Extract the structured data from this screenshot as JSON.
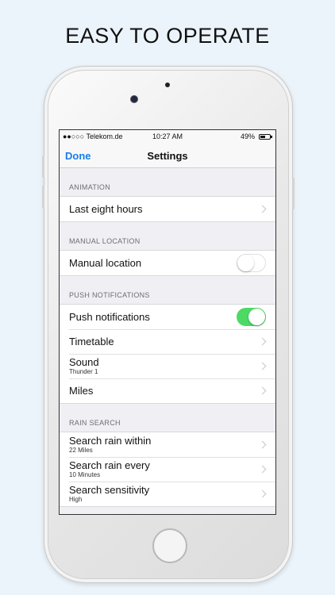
{
  "headline": "EASY TO OPERATE",
  "status_bar": {
    "carrier": "●●○○○ Telekom.de",
    "time": "10:27 AM",
    "battery": "49%"
  },
  "nav": {
    "done_label": "Done",
    "title": "Settings"
  },
  "sections": {
    "animation": {
      "header": "ANIMATION",
      "rows": [
        {
          "label": "Last eight hours"
        }
      ]
    },
    "manual_location": {
      "header": "MANUAL LOCATION",
      "rows": [
        {
          "label": "Manual location",
          "toggle": false
        }
      ]
    },
    "push_notifications": {
      "header": "PUSH NOTIFICATIONS",
      "rows": [
        {
          "label": "Push notifications",
          "toggle": true
        },
        {
          "label": "Timetable"
        },
        {
          "label": "Sound",
          "subtitle": "Thunder 1"
        },
        {
          "label": "Miles"
        }
      ]
    },
    "rain_search": {
      "header": "RAIN SEARCH",
      "rows": [
        {
          "label": "Search rain within",
          "subtitle": "22 Miles"
        },
        {
          "label": "Search rain every",
          "subtitle": "10 Minutes"
        },
        {
          "label": "Search sensitivity",
          "subtitle": "High"
        }
      ]
    }
  },
  "colors": {
    "accent": "#1a7ce8",
    "toggle_on": "#4cd964",
    "background": "#ebf4fa"
  }
}
